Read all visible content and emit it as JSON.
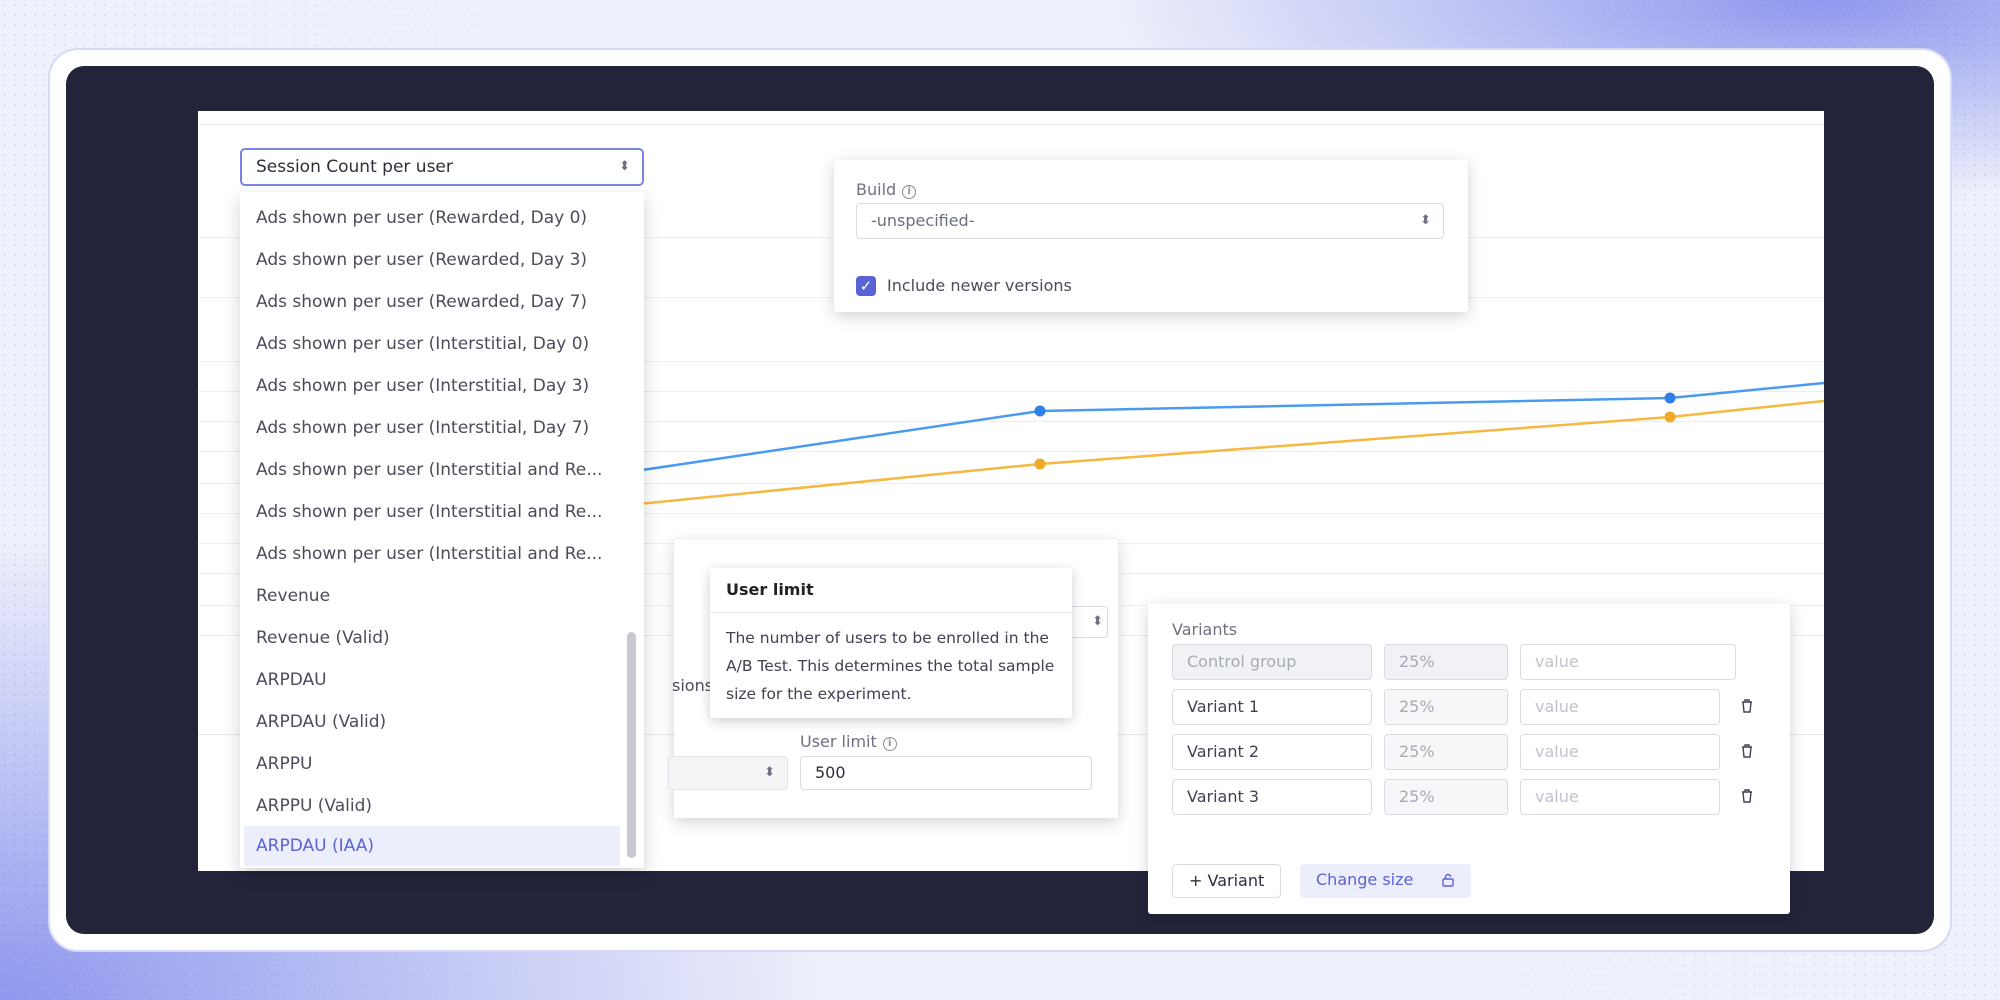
{
  "metric_select": {
    "value": "Session Count per user"
  },
  "metric_options": [
    "Ads shown per user (Rewarded, Day 0)",
    "Ads shown per user (Rewarded, Day 3)",
    "Ads shown per user (Rewarded, Day 7)",
    "Ads shown per user (Interstitial, Day 0)",
    "Ads shown per user (Interstitial, Day 3)",
    "Ads shown per user (Interstitial, Day 7)",
    "Ads shown per user (Interstitial and Re...",
    "Ads shown per user (Interstitial and Re...",
    "Ads shown per user (Interstitial and Re...",
    "Revenue",
    "Revenue (Valid)",
    "ARPDAU",
    "ARPDAU (Valid)",
    "ARPPU",
    "ARPPU (Valid)",
    "ARPDAU (IAA)"
  ],
  "build_panel": {
    "label": "Build",
    "select_value": "-unspecified-",
    "checkbox_label": "Include newer versions",
    "checked": true
  },
  "tooltip": {
    "title": "User limit",
    "body": "The number of users to be enrolled in the A/B Test. This determines the total sample size for the experiment."
  },
  "user_limit": {
    "label": "User limit",
    "value": "500",
    "clipped_text": "sions"
  },
  "variants": {
    "label": "Variants",
    "rows": [
      {
        "name": "Control group",
        "pct": "25%",
        "value_placeholder": "value"
      },
      {
        "name": "Variant 1",
        "pct": "25%",
        "value_placeholder": "value"
      },
      {
        "name": "Variant 2",
        "pct": "25%",
        "value_placeholder": "value"
      },
      {
        "name": "Variant 3",
        "pct": "25%",
        "value_placeholder": "value"
      }
    ],
    "add_button": "+ Variant",
    "change_size_button": "Change size"
  },
  "colors": {
    "accent": "#5a63d6",
    "series_blue": "#4a9bf0",
    "series_orange": "#f5b942",
    "dark": "#23243a"
  },
  "icons": [
    "chevron-updown-icon",
    "info-icon",
    "check-icon",
    "trash-icon",
    "lock-icon"
  ]
}
